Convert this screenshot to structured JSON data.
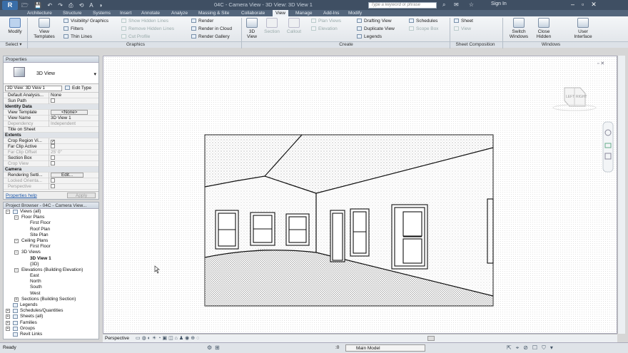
{
  "app": {
    "logo": "R",
    "title_text": "04C - Camera View - 3D View: 3D View 1",
    "search_placeholder": "Type a keyword or phrase",
    "signin": "Sign In"
  },
  "tabs": [
    "Architecture",
    "Structure",
    "Systems",
    "Insert",
    "Annotate",
    "Analyze",
    "Massing & Site",
    "Collaborate",
    "View",
    "Manage",
    "Add-Ins",
    "Modify"
  ],
  "active_tab": "View",
  "ribbon": {
    "modify": "Modify",
    "select_panel": "Select ▾",
    "view_templates": "View Templates",
    "visibility": "Visibility/ Graphics",
    "filters": "Filters",
    "thin_lines": "Thin Lines",
    "show_hidden": "Show Hidden Lines",
    "remove_hidden": "Remove Hidden Lines",
    "cut_profile": "Cut Profile",
    "render": "Render",
    "render_cloud": "Render in Cloud",
    "render_gallery": "Render Gallery",
    "btn_3d": "3D View",
    "section": "Section",
    "callout": "Callout",
    "plan_views": "Plan Views",
    "elevation": "Elevation",
    "drafting": "Drafting View",
    "duplicate": "Duplicate View",
    "legends": "Legends",
    "schedules": "Schedules",
    "scope_box": "Scope Box",
    "sheet": "Sheet",
    "view_btn": "View",
    "switch_windows": "Switch Windows",
    "close_hidden": "Close Hidden",
    "user_interface": "User Interface",
    "panels": {
      "select": "Select ▾",
      "graphics": "Graphics",
      "create": "Create",
      "sheet_comp": "Sheet Composition",
      "windows": "Windows"
    }
  },
  "properties": {
    "header": "Properties",
    "type_name": "3D View",
    "instance": "3D View: 3D View 1",
    "edit_type": "Edit Type",
    "rows": [
      {
        "k": "Default Analysis...",
        "v": "None",
        "kind": "row"
      },
      {
        "k": "Sun Path",
        "v": "",
        "kind": "check"
      },
      {
        "k": "Identity Data",
        "v": "",
        "kind": "group"
      },
      {
        "k": "View Template",
        "v": "<None>",
        "kind": "button"
      },
      {
        "k": "View Name",
        "v": "3D View 1",
        "kind": "row"
      },
      {
        "k": "Dependency",
        "v": "Independent",
        "kind": "dim"
      },
      {
        "k": "Title on Sheet",
        "v": "",
        "kind": "row"
      },
      {
        "k": "Extents",
        "v": "",
        "kind": "group"
      },
      {
        "k": "Crop Region Vi...",
        "v": "✓",
        "kind": "check"
      },
      {
        "k": "Far Clip Active",
        "v": "",
        "kind": "check"
      },
      {
        "k": "Far Clip Offset",
        "v": "25' 0\"",
        "kind": "dim"
      },
      {
        "k": "Section Box",
        "v": "",
        "kind": "check"
      },
      {
        "k": "Crop View",
        "v": "",
        "kind": "checkdim"
      },
      {
        "k": "Camera",
        "v": "",
        "kind": "group"
      },
      {
        "k": "Rendering Setti...",
        "v": "Edit...",
        "kind": "button"
      },
      {
        "k": "Locked Orienta...",
        "v": "",
        "kind": "checkdim"
      },
      {
        "k": "Perspective",
        "v": "",
        "kind": "checkdim"
      }
    ],
    "help_link": "Properties help",
    "apply": "Apply"
  },
  "browser": {
    "header": "Project Browser - 04C - Camera View...",
    "nodes": [
      {
        "t": "Views (all)",
        "d": 0,
        "tg": "−",
        "ico": true
      },
      {
        "t": "Floor Plans",
        "d": 1,
        "tg": "−"
      },
      {
        "t": "First Floor",
        "d": 2
      },
      {
        "t": "Roof Plan",
        "d": 2
      },
      {
        "t": "Site Plan",
        "d": 2
      },
      {
        "t": "Ceiling Plans",
        "d": 1,
        "tg": "−"
      },
      {
        "t": "First Floor",
        "d": 2
      },
      {
        "t": "3D Views",
        "d": 1,
        "tg": "−"
      },
      {
        "t": "3D View 1",
        "d": 2,
        "b": true
      },
      {
        "t": "{3D}",
        "d": 2
      },
      {
        "t": "Elevations (Building Elevation)",
        "d": 1,
        "tg": "−"
      },
      {
        "t": "East",
        "d": 2
      },
      {
        "t": "North",
        "d": 2
      },
      {
        "t": "South",
        "d": 2
      },
      {
        "t": "West",
        "d": 2
      },
      {
        "t": "Sections (Building Section)",
        "d": 1,
        "tg": "+"
      },
      {
        "t": "Legends",
        "d": 0,
        "ico": true
      },
      {
        "t": "Schedules/Quantities",
        "d": 0,
        "tg": "+",
        "ico": true
      },
      {
        "t": "Sheets (all)",
        "d": 0,
        "tg": "+",
        "ico": true
      },
      {
        "t": "Families",
        "d": 0,
        "tg": "+",
        "ico": true
      },
      {
        "t": "Groups",
        "d": 0,
        "tg": "+",
        "ico": true
      },
      {
        "t": "Revit Links",
        "d": 0,
        "ico": true
      }
    ]
  },
  "viewport": {
    "viewcube_left": "LEFT",
    "viewcube_right": "RIGHT",
    "view_label": "Perspective"
  },
  "status": {
    "ready": "Ready",
    "workset": "Main Model",
    "zero": ":0"
  }
}
